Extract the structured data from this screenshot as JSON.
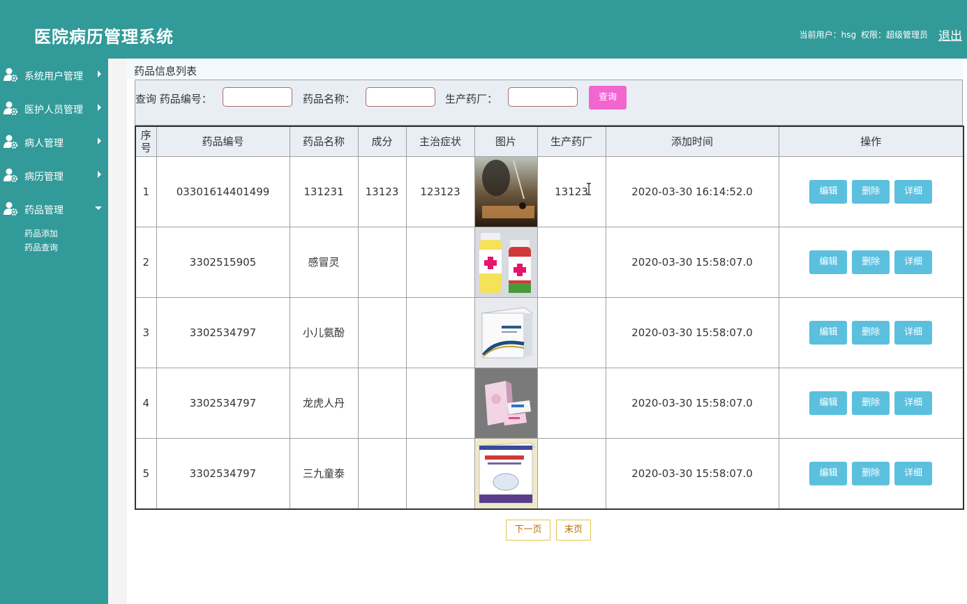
{
  "header": {
    "title": "医院病历管理系统",
    "current_user_label": "当前用户：hsg",
    "permission_label": "权限：超级管理员",
    "logout": "退出"
  },
  "sidebar": {
    "items": [
      {
        "label": "系统用户管理",
        "icon": "user-gear-icon"
      },
      {
        "label": "医护人员管理",
        "icon": "user-gear-icon"
      },
      {
        "label": "病人管理",
        "icon": "user-gear-icon"
      },
      {
        "label": "病历管理",
        "icon": "user-gear-icon"
      },
      {
        "label": "药品管理",
        "icon": "user-gear-icon"
      }
    ],
    "subitems": [
      "药品添加",
      "药品查询"
    ]
  },
  "page": {
    "title": "药品信息列表"
  },
  "search": {
    "query_label": "查询 药品编号：",
    "name_label": "药品名称：",
    "factory_label": "生产药厂：",
    "code_value": "",
    "name_value": "",
    "factory_value": "",
    "button": "查询"
  },
  "table": {
    "headers": [
      "序号",
      "药品编号",
      "药品名称",
      "成分",
      "主治症状",
      "图片",
      "生产药厂",
      "添加时间",
      "操作"
    ],
    "rows": [
      {
        "idx": "1",
        "code": "03301614401499",
        "name": "131231",
        "ingredient": "13123",
        "symptom": "123123",
        "image": "incense-photo",
        "factory": "13123",
        "time": "2020-03-30 16:14:52.0"
      },
      {
        "idx": "2",
        "code": "3302515905",
        "name": "感冒灵",
        "ingredient": "",
        "symptom": "",
        "image": "pill-bottles-photo",
        "factory": "",
        "time": "2020-03-30 15:58:07.0"
      },
      {
        "idx": "3",
        "code": "3302534797",
        "name": "小儿氨酚",
        "ingredient": "",
        "symptom": "",
        "image": "medicine-box-photo",
        "factory": "",
        "time": "2020-03-30 15:58:07.0"
      },
      {
        "idx": "4",
        "code": "3302534797",
        "name": "龙虎人丹",
        "ingredient": "",
        "symptom": "",
        "image": "cosmetic-boxes-photo",
        "factory": "",
        "time": "2020-03-30 15:58:07.0"
      },
      {
        "idx": "5",
        "code": "3302534797",
        "name": "三九童泰",
        "ingredient": "",
        "symptom": "",
        "image": "medicine-package-photo",
        "factory": "",
        "time": "2020-03-30 15:58:07.0"
      }
    ],
    "actions": {
      "edit": "编辑",
      "delete": "删除",
      "detail": "详细"
    }
  },
  "pagination": {
    "next": "下一页",
    "last": "末页"
  },
  "colors": {
    "theme": "#329a99",
    "query_button": "#f166cf",
    "action_button": "#5bc0de"
  }
}
